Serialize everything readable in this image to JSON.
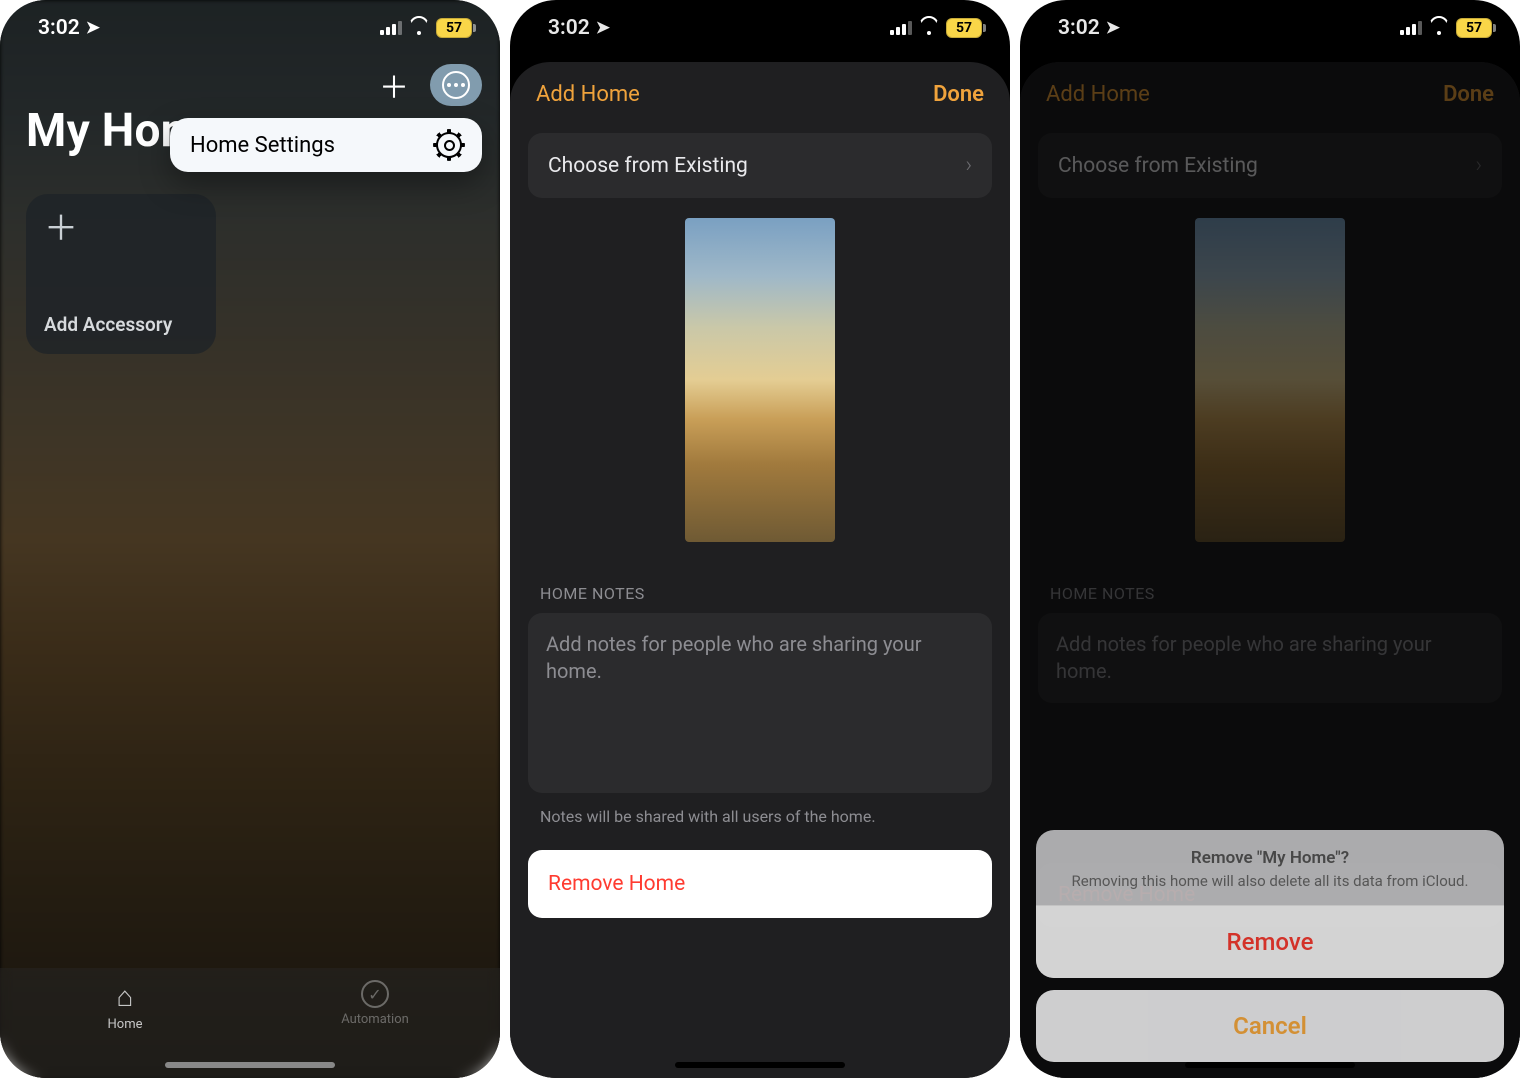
{
  "status": {
    "time": "3:02",
    "battery": "57"
  },
  "screen1": {
    "title": "My Hon",
    "popup_label": "Home Settings",
    "tile_label": "Add Accessory",
    "tab_home": "Home",
    "tab_automation": "Automation"
  },
  "sheet": {
    "add_home": "Add Home",
    "done": "Done",
    "choose": "Choose from Existing",
    "section": "HOME NOTES",
    "notes_placeholder": "Add notes for people who are sharing your home.",
    "footer": "Notes will be shared with all users of the home.",
    "remove": "Remove Home"
  },
  "actionsheet": {
    "title": "Remove \"My Home\"?",
    "message": "Removing this home will also delete all its data from iCloud.",
    "remove": "Remove",
    "cancel": "Cancel"
  }
}
